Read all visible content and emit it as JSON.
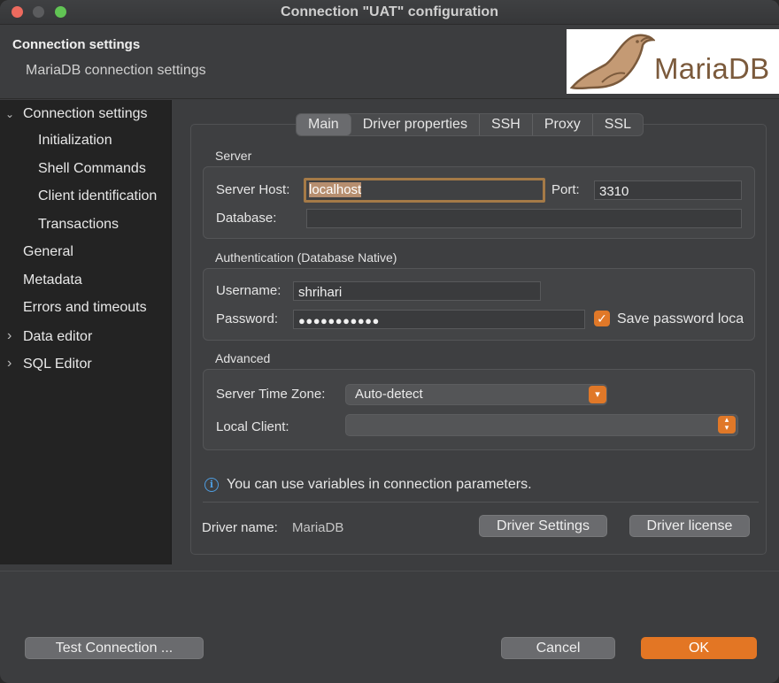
{
  "window": {
    "title": "Connection \"UAT\" configuration"
  },
  "header": {
    "title": "Connection settings",
    "subtitle": "MariaDB connection settings",
    "logo_text": "MariaDB"
  },
  "sidebar": {
    "items": [
      {
        "label": "Connection settings",
        "chevron": "⌄"
      },
      {
        "label": "Initialization"
      },
      {
        "label": "Shell Commands"
      },
      {
        "label": "Client identification"
      },
      {
        "label": "Transactions"
      },
      {
        "label": "General"
      },
      {
        "label": "Metadata"
      },
      {
        "label": "Errors and timeouts"
      },
      {
        "label": "Data editor",
        "chevron": "›"
      },
      {
        "label": "SQL Editor",
        "chevron": "›"
      }
    ]
  },
  "tabs": [
    "Main",
    "Driver properties",
    "SSH",
    "Proxy",
    "SSL"
  ],
  "server": {
    "group_label": "Server",
    "host_label": "Server Host:",
    "host_value": "localhost",
    "port_label": "Port:",
    "port_value": "3310",
    "database_label": "Database:",
    "database_value": ""
  },
  "auth": {
    "group_label": "Authentication (Database Native)",
    "username_label": "Username:",
    "username_value": "shrihari",
    "password_label": "Password:",
    "password_value": "●●●●●●●●●●●",
    "save_password_label": "Save password loca"
  },
  "advanced": {
    "group_label": "Advanced",
    "timezone_label": "Server Time Zone:",
    "timezone_value": "Auto-detect",
    "local_client_label": "Local Client:",
    "local_client_value": ""
  },
  "info": {
    "text": "You can use variables in connection parameters.",
    "icon": "i"
  },
  "driver": {
    "name_label": "Driver name:",
    "name_value": "MariaDB",
    "settings_button": "Driver Settings",
    "license_button": "Driver license"
  },
  "footer": {
    "test_button": "Test Connection ...",
    "cancel_button": "Cancel",
    "ok_button": "OK"
  },
  "colors": {
    "accent": "#e37624",
    "focus_border": "#a57a47",
    "info": "#4f9de0",
    "brand": "#7b5a3c"
  }
}
